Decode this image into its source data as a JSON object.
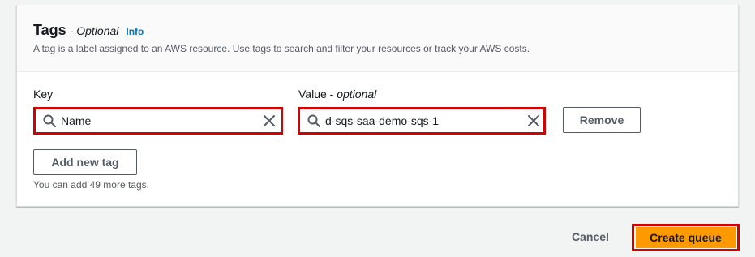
{
  "tags_panel": {
    "title": "Tags",
    "title_optional": "- Optional",
    "info_link": "Info",
    "description": "A tag is a label assigned to an AWS resource. Use tags to search and filter your resources or track your AWS costs."
  },
  "tag_row": {
    "key_label": "Key",
    "value_label": "Value -",
    "value_label_optional": "optional",
    "key_value": "Name",
    "value_value": "d-sqs-saa-demo-sqs-1",
    "remove_label": "Remove"
  },
  "add_tag": {
    "label": "Add new tag",
    "hint": "You can add 49 more tags."
  },
  "footer": {
    "cancel_label": "Cancel",
    "create_label": "Create queue"
  },
  "colors": {
    "primary": "#ff9900",
    "highlight": "#d50000",
    "link": "#0073bb"
  },
  "icons": [
    "search-icon",
    "close-icon"
  ]
}
